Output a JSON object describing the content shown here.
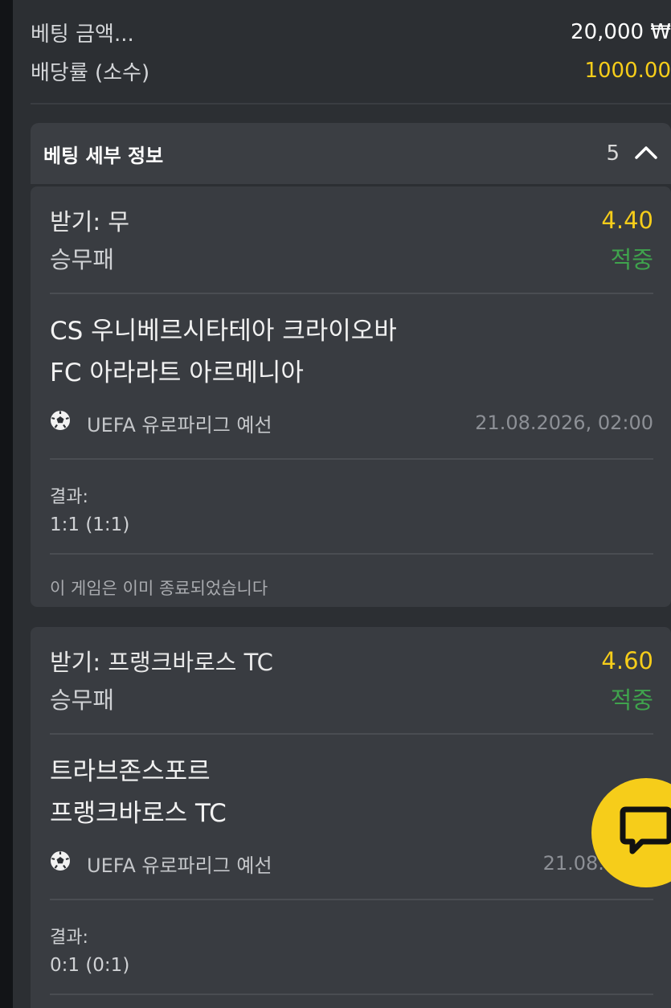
{
  "summary": {
    "stake_label": "베팅 금액...",
    "stake_value": "20,000 ₩",
    "odds_label": "배당률 (소수)",
    "odds_value": "1000.00"
  },
  "details": {
    "title": "베팅 세부 정보",
    "count": "5"
  },
  "bets": [
    {
      "pick": "받기: 무",
      "odds": "4.40",
      "market": "승무패",
      "status": "적중",
      "home": "CS 우니베르시타테아 크라이오바",
      "away": "FC 아라라트 아르메니아",
      "league": "UEFA 유로파리그 예선",
      "date": "21.08.2026, 02:00",
      "result_label": "결과:",
      "result_value": "1:1 (1:1)",
      "note": "이 게임은 이미 종료되었습니다"
    },
    {
      "pick": "받기: 프랭크바로스 TC",
      "odds": "4.60",
      "market": "승무패",
      "status": "적중",
      "home": "트라브존스포르",
      "away": "프랭크바로스 TC",
      "league": "UEFA 유로파리그 예선",
      "date": "21.08.2026",
      "result_label": "결과:",
      "result_value": "0:1 (0:1)"
    }
  ],
  "colors": {
    "accent_yellow": "#f6cd1a",
    "win_green": "#3fa34d",
    "panel": "#2c2f33",
    "card": "#393c41"
  },
  "icons": {
    "sport": "soccer-ball-icon",
    "collapse": "chevron-up-icon",
    "chat": "chat-bubble-icon"
  }
}
